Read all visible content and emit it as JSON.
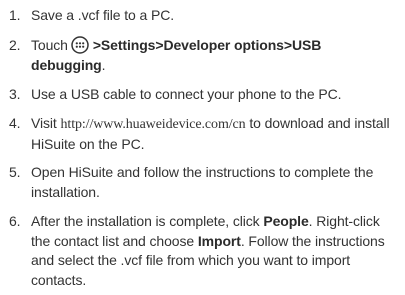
{
  "steps": [
    {
      "n": "1.",
      "text": "Save a .vcf file to a PC."
    },
    {
      "n": "2.",
      "before": "Touch",
      "path": ">Settings>Developer options>USB debugging",
      "after": ".",
      "icon": "menu-icon"
    },
    {
      "n": "3.",
      "text": "Use a USB cable to connect your phone to the PC."
    },
    {
      "n": "4.",
      "before": "Visit ",
      "url": "http://www.huaweidevice.com/cn",
      "after": " to download and install HiSuite on the PC."
    },
    {
      "n": "5.",
      "text": "Open HiSuite and follow the instructions to complete the installation."
    },
    {
      "n": "6.",
      "t1": "After the installation is complete, click ",
      "people": "People",
      "t2": ". Right-click the contact list and choose ",
      "import": "Import",
      "t3": ". Follow the instructions and select the .vcf file from which you want to import contacts."
    }
  ]
}
